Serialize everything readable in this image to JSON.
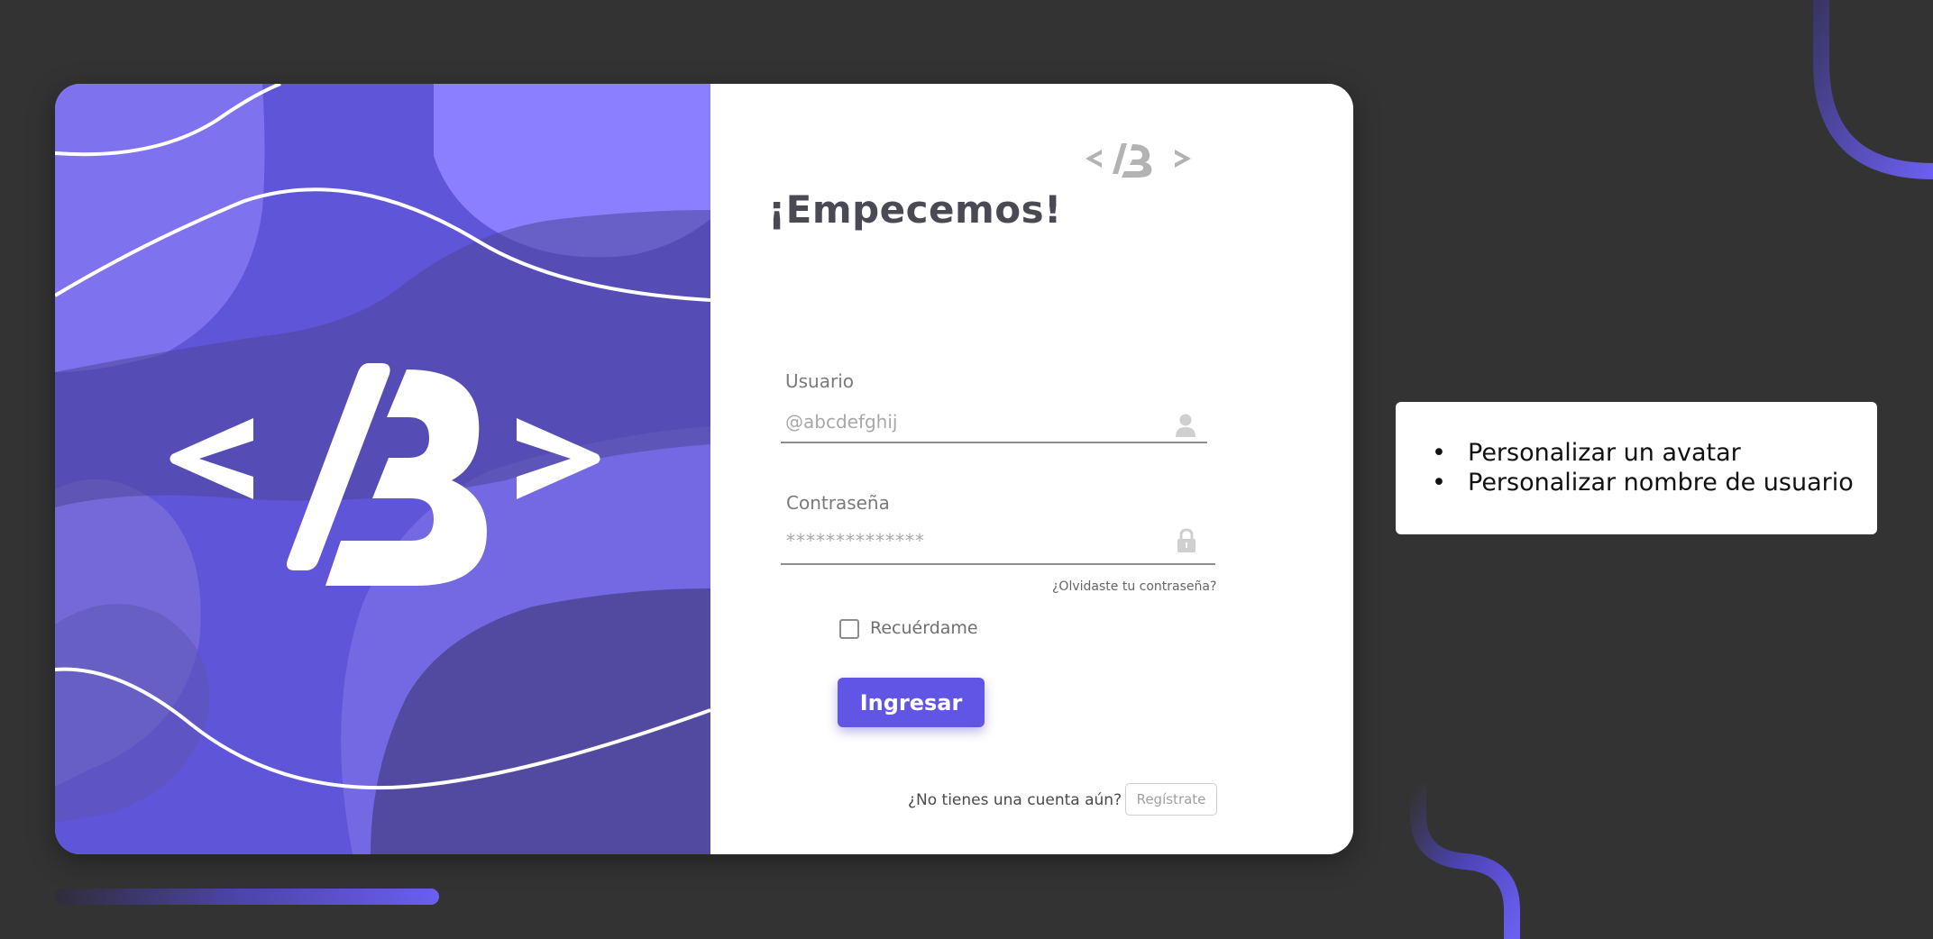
{
  "login": {
    "heading": "¡Empecemos!",
    "username": {
      "label": "Usuario",
      "placeholder": "@abcdefghij"
    },
    "password": {
      "label": "Contraseña",
      "placeholder": "**************"
    },
    "forgot_link": "¿Olvidaste tu contraseña?",
    "remember_label": "Recuérdame",
    "submit_label": "Ingresar",
    "no_account_text": "¿No tienes una cuenta aún?",
    "register_label": "Regístrate"
  },
  "notes": {
    "items": [
      "Personalizar un avatar",
      "Personalizar nombre de usuario"
    ]
  },
  "icons": {
    "username": "user-icon",
    "password": "lock-icon"
  },
  "colors": {
    "background": "#333333",
    "accent": "#6155e6",
    "art_primary": "#5f55d9",
    "art_light": "#867cf8",
    "art_dark": "#4d4598",
    "heading": "#4a4a55"
  }
}
